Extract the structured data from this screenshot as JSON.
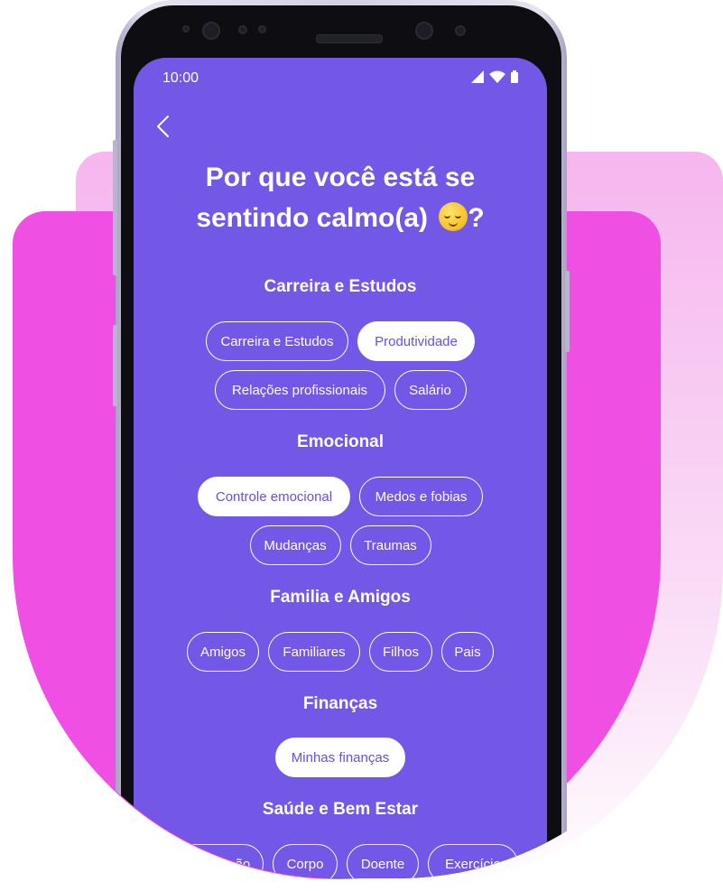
{
  "status_bar": {
    "time": "10:00"
  },
  "header": {
    "title_line1": "Por que você está se",
    "title_line2": "sentindo calmo(a)",
    "title_suffix": "?",
    "emoji": "relieved-face"
  },
  "sections": [
    {
      "title": "Carreira e Estudos",
      "rows": [
        [
          {
            "label": "Carreira e Estudos",
            "selected": false
          },
          {
            "label": "Produtividade",
            "selected": true
          }
        ],
        [
          {
            "label": "Relações profissionais",
            "selected": false
          },
          {
            "label": "Salário",
            "selected": false
          }
        ]
      ]
    },
    {
      "title": "Emocional",
      "rows": [
        [
          {
            "label": "Controle emocional",
            "selected": true
          },
          {
            "label": "Medos e fobias",
            "selected": false
          }
        ],
        [
          {
            "label": "Mudanças",
            "selected": false
          },
          {
            "label": "Traumas",
            "selected": false
          }
        ]
      ]
    },
    {
      "title": "Familia e Amigos",
      "rows": [
        [
          {
            "label": "Amigos",
            "selected": false
          },
          {
            "label": "Familiares",
            "selected": false
          },
          {
            "label": "Filhos",
            "selected": false
          },
          {
            "label": "Pais",
            "selected": false
          }
        ]
      ]
    },
    {
      "title": "Finanças",
      "rows": [
        [
          {
            "label": "Minhas finanças",
            "selected": true
          }
        ]
      ]
    },
    {
      "title": "Saúde e Bem Estar",
      "rows": [
        [
          {
            "label": "Alimentação",
            "selected": false
          },
          {
            "label": "Corpo",
            "selected": false
          },
          {
            "label": "Doente",
            "selected": false
          },
          {
            "label": "Exercício",
            "selected": false
          }
        ]
      ]
    }
  ],
  "colors": {
    "screen_bg": "#7357e6",
    "selected_chip_text": "#6a4fdc",
    "accent_magenta": "#ef4fe3"
  }
}
